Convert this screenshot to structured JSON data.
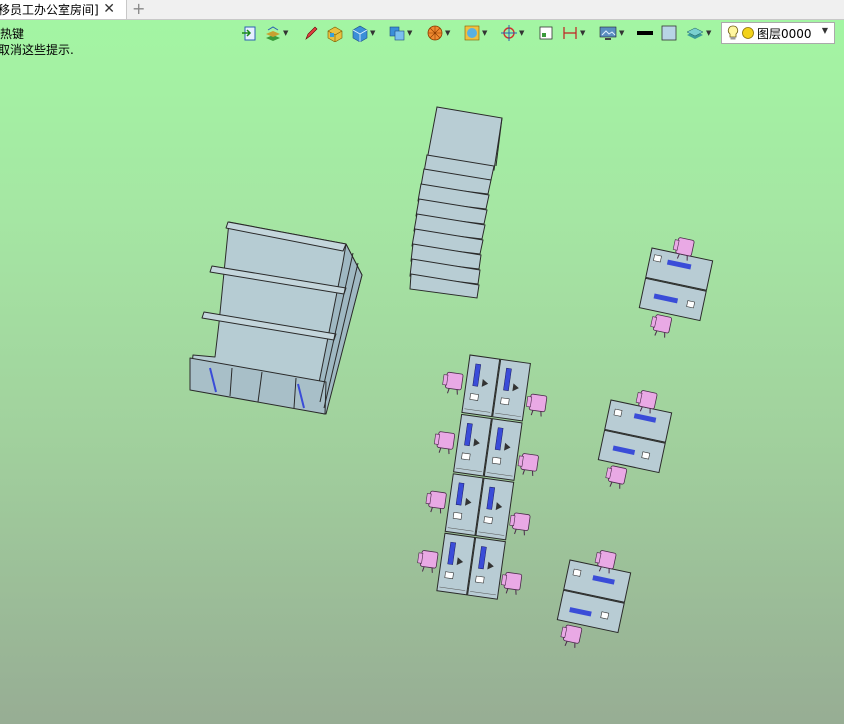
{
  "tab": {
    "title": "移员工办公室房间]",
    "close": "✕",
    "new_tab": "+"
  },
  "hints": [
    "热键",
    "取消这些提示."
  ],
  "toolbar": {
    "layer_name": "图层0000",
    "icons": [
      "open-door-icon",
      "stack-icon",
      "pen-icon",
      "box-color-icon",
      "cube-icon",
      "copy-cube-icon",
      "wheel-icon",
      "render-icon",
      "target-icon",
      "frame-icon",
      "dimension-icon",
      "screen-icon",
      "line-color-icon",
      "fill-color-icon",
      "layer-stack-icon"
    ]
  },
  "colors": {
    "desk": "#b8ccd4",
    "chair": "#e9a9e5",
    "outline": "#2a2a2a",
    "accent": "#3a4cd8"
  }
}
